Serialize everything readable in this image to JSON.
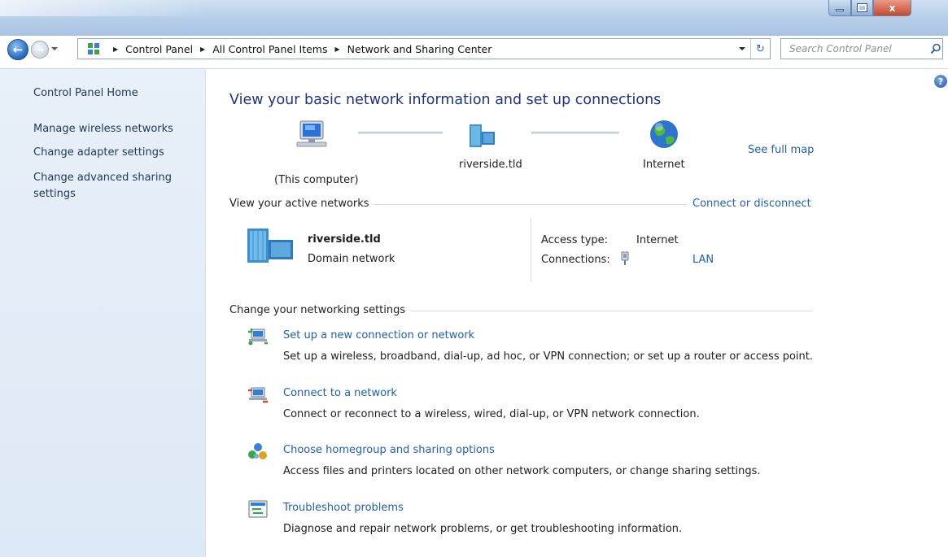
{
  "window": {
    "minimize_glyph": "",
    "maximize_glyph": "",
    "close_glyph": "x"
  },
  "navigation": {
    "breadcrumbs": [
      "Control Panel",
      "All Control Panel Items",
      "Network and Sharing Center"
    ],
    "search_placeholder": "Search Control Panel"
  },
  "sidebar": {
    "home": "Control Panel Home",
    "items": [
      "Manage wireless networks",
      "Change adapter settings",
      "Change advanced sharing settings"
    ]
  },
  "main": {
    "title": "View your basic network information and set up connections",
    "see_full_map": "See full map",
    "map": {
      "computer_label": "(This computer)",
      "domain_label": "riverside.tld",
      "internet_label": "Internet"
    },
    "active_networks": {
      "heading": "View your active networks",
      "connect_link": "Connect or disconnect",
      "network_name": "riverside.tld",
      "network_type": "Domain network",
      "access_type_label": "Access type:",
      "access_type_value": "Internet",
      "connections_label": "Connections:",
      "connections_value": "LAN"
    },
    "settings": {
      "heading": "Change your networking settings",
      "tasks": [
        {
          "icon": "new-connection-icon",
          "title": "Set up a new connection or network",
          "description": "Set up a wireless, broadband, dial-up, ad hoc, or VPN connection; or set up a router or access point."
        },
        {
          "icon": "connect-network-icon",
          "title": "Connect to a network",
          "description": "Connect or reconnect to a wireless, wired, dial-up, or VPN network connection."
        },
        {
          "icon": "homegroup-icon",
          "title": "Choose homegroup and sharing options",
          "description": "Access files and printers located on other network computers, or change sharing settings."
        },
        {
          "icon": "troubleshoot-icon",
          "title": "Troubleshoot problems",
          "description": "Diagnose and repair network problems, or get troubleshooting information."
        }
      ]
    }
  },
  "colors": {
    "link": "#1e5fb0",
    "title": "#1e3287",
    "sidebar_bg": "#e2ecf7"
  }
}
